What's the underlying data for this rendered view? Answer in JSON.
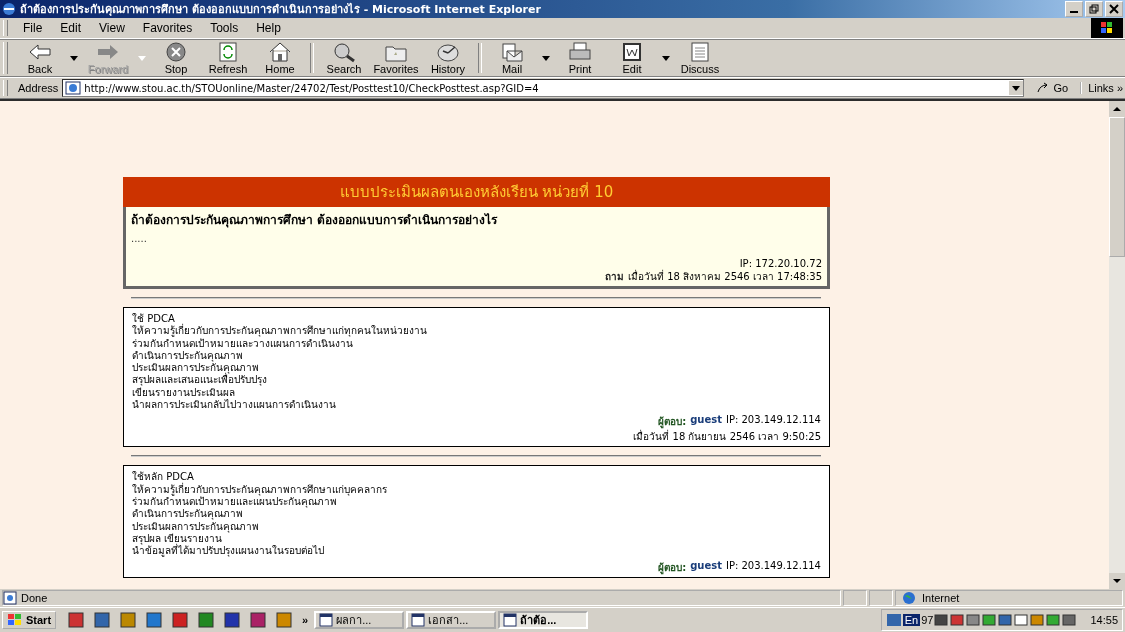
{
  "window": {
    "title": "ถ้าต้องการประกันคุณภาพการศึกษา ต้องออกแบบการดำเนินการอย่างไร - Microsoft Internet Explorer"
  },
  "menu": [
    "File",
    "Edit",
    "View",
    "Favorites",
    "Tools",
    "Help"
  ],
  "toolbar": [
    {
      "label": "Back",
      "kind": "back",
      "disabled": false,
      "dropdown": true
    },
    {
      "label": "Forward",
      "kind": "forward",
      "disabled": true,
      "dropdown": true
    },
    {
      "label": "Stop",
      "kind": "stop",
      "disabled": false,
      "dropdown": false
    },
    {
      "label": "Refresh",
      "kind": "refresh",
      "disabled": false,
      "dropdown": false
    },
    {
      "label": "Home",
      "kind": "home",
      "disabled": false,
      "dropdown": false
    },
    {
      "label": "Search",
      "kind": "search",
      "disabled": false,
      "dropdown": false
    },
    {
      "label": "Favorites",
      "kind": "favorites",
      "disabled": false,
      "dropdown": false
    },
    {
      "label": "History",
      "kind": "history",
      "disabled": false,
      "dropdown": false
    },
    {
      "label": "Mail",
      "kind": "mail",
      "disabled": false,
      "dropdown": true
    },
    {
      "label": "Print",
      "kind": "print",
      "disabled": false,
      "dropdown": false
    },
    {
      "label": "Edit",
      "kind": "edit",
      "disabled": false,
      "dropdown": true
    },
    {
      "label": "Discuss",
      "kind": "discuss",
      "disabled": false,
      "dropdown": false
    }
  ],
  "address": {
    "label": "Address",
    "value": "http://www.stou.ac.th/STOUonline/Master/24702/Test/Posttest10/CheckPosttest.asp?GID=4",
    "go": "Go",
    "links": "Links »"
  },
  "page": {
    "header": "แบบประเมินผลตนเองหลังเรียน หน่วยที่ 10",
    "question": {
      "title": "ถ้าต้องการประกันคุณภาพการศึกษา ต้องออกแบบการดำเนินการอย่างไร",
      "body": ".....",
      "ip": "IP: 172.20.10.72",
      "asked_label": "ถาม",
      "asked_date": "เมื่อวันที่ 18 สิงหาคม 2546 เวลา 17:48:35"
    },
    "answers": [
      {
        "lines": [
          "ใช้ PDCA",
          "ให้ความรู้เกี่ยวกับการประกันคุณภาพการศึกษาแก่ทุกคนในหน่วยงาน",
          "ร่วมกันกำหนดเป้าหมายและวางแผนการดำเนินงาน",
          "ดำเนินการประกันคุณภาพ",
          "ประเมินผลการประกันคุณภาพ",
          "สรุปผลและเสนอแนะเพื่อปรับปรุง",
          "เขียนรายงานประเมินผล",
          "นำผลการประเมินกลับไปวางแผนการดำเนินงาน"
        ],
        "answerer_label": "ผู้ตอบ:",
        "answerer": "guest",
        "ip": "IP: 203.149.12.114",
        "date": "เมื่อวันที่ 18 กันยายน 2546 เวลา 9:50:25"
      },
      {
        "lines": [
          "ใช้หลัก PDCA",
          "ให้ความรู้เกี่ยวกับการประกันคุณภาพการศึกษาแก่บุคคลากร",
          "ร่วมกันกำหนดเป้าหมายและแผนประกันคุณภาพ",
          "ดำเนินการประกันคุณภาพ",
          "ประเมินผลการประกันคุณภาพ",
          "สรุปผล เขียนรายงาน",
          "นำข้อมูลที่ได้มาปรับปรุงแผนงานในรอบต่อไป"
        ],
        "answerer_label": "ผู้ตอบ:",
        "answerer": "guest",
        "ip": "IP: 203.149.12.114"
      }
    ]
  },
  "status_bar": {
    "text": "Done",
    "zone": "Internet"
  },
  "taskbar": {
    "start": "Start",
    "quick_launch_more": "»",
    "tasks": [
      {
        "label": "ผลกา...",
        "selected": false
      },
      {
        "label": "เอกสา...",
        "selected": false
      },
      {
        "label": "ถ้าต้อ...",
        "selected": true
      }
    ],
    "tray_lang": "En",
    "tray_num": "97",
    "clock": "14:55"
  }
}
